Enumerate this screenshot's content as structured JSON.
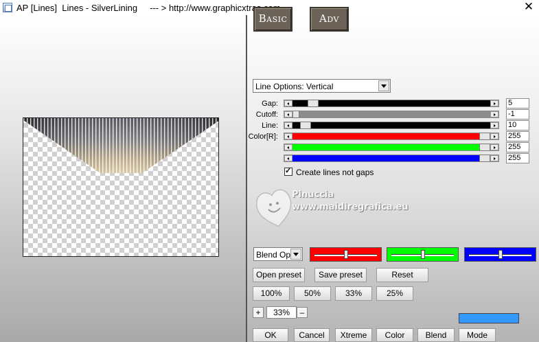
{
  "window": {
    "title": "AP [Lines]  Lines - SilverLining     --- > http://www.graphicxtras.com",
    "close_glyph": "✕"
  },
  "tabs": {
    "basic": "Basic",
    "adv": "Adv"
  },
  "line_options": {
    "selected": "Line Options: Vertical"
  },
  "sliders": [
    {
      "label": "Gap:",
      "value": "5",
      "fill_color": "#000000",
      "thumb_fraction": 0.08
    },
    {
      "label": "Cutoff:",
      "value": "-1",
      "fill_color": "#8c8c8c",
      "thumb_fraction": 0.0
    },
    {
      "label": "Line:",
      "value": "10",
      "fill_color": "#000000",
      "thumb_fraction": 0.04
    },
    {
      "label": "Color[R]:",
      "value": "255",
      "fill_color": "#ff0000",
      "thumb_fraction": 1.0
    },
    {
      "label": "",
      "value": "255",
      "fill_color": "#00ff00",
      "thumb_fraction": 1.0
    },
    {
      "label": "",
      "value": "255",
      "fill_color": "#0000ff",
      "thumb_fraction": 1.0
    }
  ],
  "checkbox": {
    "label": "Create lines not gaps",
    "checked": true
  },
  "watermark": {
    "line1": "Pinuccia",
    "line2": "www.maidiregrafica.eu"
  },
  "blend_options": {
    "selected": "Blend Optio"
  },
  "color_boxes": [
    {
      "color": "#ff0000",
      "level": 0.5
    },
    {
      "color": "#00ff00",
      "level": 0.5
    },
    {
      "color": "#0000ff",
      "level": 0.5
    }
  ],
  "preset_buttons": {
    "open": "Open preset",
    "save": "Save preset",
    "reset": "Reset"
  },
  "zoom_buttons": [
    "100%",
    "50%",
    "33%",
    "25%"
  ],
  "zoom": {
    "plus": "+",
    "value": "33%",
    "minus": "–"
  },
  "color_preview": "#3399ff",
  "bottom_buttons": [
    "OK",
    "Cancel",
    "Xtreme",
    "Color",
    "Blend",
    "Mode"
  ]
}
